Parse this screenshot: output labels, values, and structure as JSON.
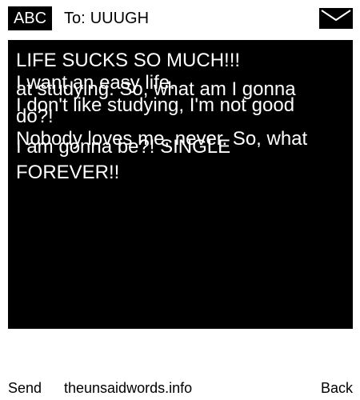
{
  "header": {
    "input_mode": "ABC",
    "to_prefix": "To:",
    "recipient": "UUUGH",
    "icon": "envelope-icon"
  },
  "message": {
    "lines": [
      "LIFE SUCKS SO MUCH!!!",
      "I want an easy life.",
      "at studying. So, what am I gonna",
      "I don't like studying, I'm not good",
      "do?!",
      "Nobody loves me, never. So, what",
      "I am gonna be?! SINGLE",
      "FOREVER!!"
    ]
  },
  "softkeys": {
    "left": "Send",
    "center": "theunsaidwords.info",
    "right": "Back"
  },
  "colors": {
    "background": "#ffffff",
    "message_bg": "#000000",
    "message_text": "#ffffff",
    "text": "#000000"
  }
}
